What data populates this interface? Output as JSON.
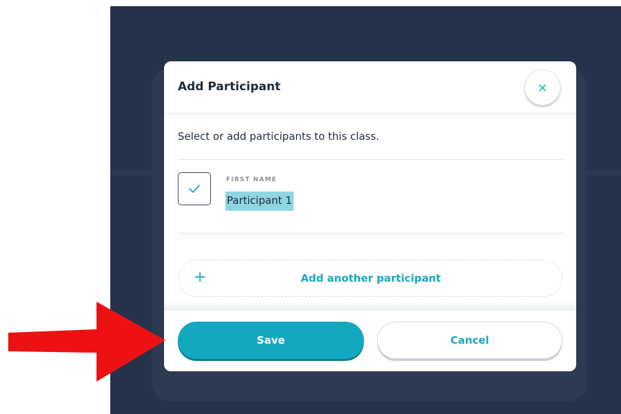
{
  "modal": {
    "title": "Add Participant",
    "close_icon": "close-icon",
    "close_glyph": "×",
    "instructions": "Select or add participants to this class.",
    "participant": {
      "checked": true,
      "field_label": "FIRST NAME",
      "value": "Participant 1"
    },
    "add_another": {
      "plus_glyph": "+",
      "label": "Add another participant"
    },
    "footer": {
      "save_label": "Save",
      "cancel_label": "Cancel"
    }
  },
  "annotation": {
    "arrow_icon": "red-arrow-icon",
    "color": "#ee1111"
  },
  "colors": {
    "accent": "#13a8bf",
    "backdrop": "#24324a",
    "title_text": "#1e2a3c",
    "highlight": "#8fd6e0"
  }
}
